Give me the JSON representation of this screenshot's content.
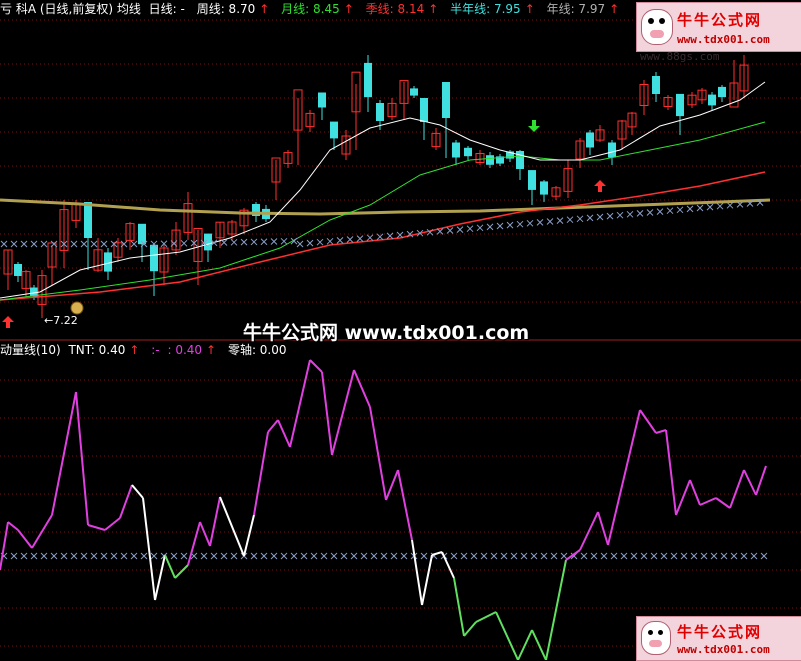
{
  "top_header": {
    "prefix": "亏 科A (日线,前复权) 均线",
    "items": [
      {
        "label": "日线: -",
        "color": "#ffffff"
      },
      {
        "label": "周线: 8.70",
        "color": "#ffffff",
        "arrow": "↑"
      },
      {
        "label": "月线: 8.45",
        "color": "#30e030",
        "arrow": "↑"
      },
      {
        "label": "季线: 8.14",
        "color": "#ff3030",
        "arrow": "↑"
      },
      {
        "label": "半年线: 7.95",
        "color": "#40e0e0",
        "arrow": "↑"
      },
      {
        "label": "年线: 7.97",
        "color": "#b0b0b0",
        "arrow": "↑"
      }
    ]
  },
  "low_price_label": "←7.22",
  "lower_header": {
    "name": "动量线(10)",
    "items": [
      {
        "label": "TNT: 0.40",
        "color": "#ffffff",
        "arrow": "↑"
      },
      {
        "label": ":-",
        "color": "#e040e0"
      },
      {
        "label": ": 0.40",
        "color": "#e040e0",
        "arrow": "↑"
      },
      {
        "label": "零轴: 0.00",
        "color": "#ffffff"
      }
    ]
  },
  "watermark": {
    "title": "牛牛公式网",
    "url_top": "www.tdx001.com",
    "url_bottom": "www.tdx001.com",
    "faint_url": "www.88gs.com",
    "center_text": "牛牛公式网 www.tdx001.com"
  },
  "colors": {
    "candle_up": "#ff3030",
    "candle_down": "#40e0e0",
    "ma_white": "#ffffff",
    "ma_green": "#30e030",
    "ma_red": "#ff3030",
    "ma_olive": "#b0a050",
    "x_marks": "#8aa0c8",
    "mtm_magenta": "#e040e0",
    "mtm_green": "#60e060",
    "mtm_white": "#ffffff"
  }
}
